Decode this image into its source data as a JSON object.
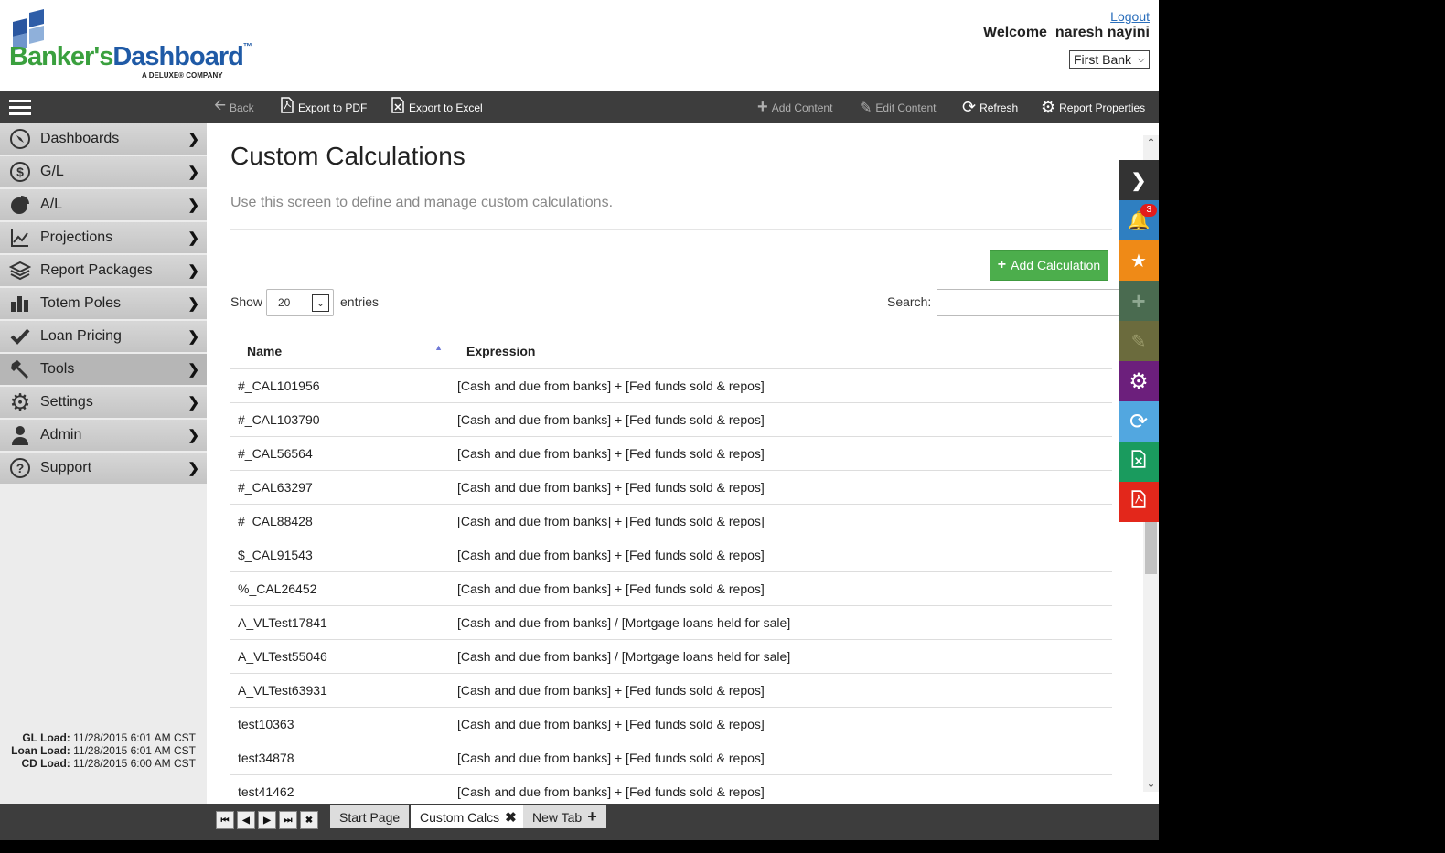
{
  "header": {
    "brand_part1": "Banker's",
    "brand_part2": "Dashboard",
    "brand_tm": "™",
    "tagline": "A DELUXE® COMPANY",
    "logout": "Logout",
    "welcome": "Welcome  naresh nayini",
    "bank": "First Bank",
    "colors": {
      "green": "#3aa03e",
      "blue": "#1f5aa6"
    }
  },
  "toolbar": {
    "back": "Back",
    "export_pdf": "Export to PDF",
    "export_excel": "Export to Excel",
    "add_content": "Add Content",
    "edit_content": "Edit Content",
    "refresh": "Refresh",
    "report_properties": "Report Properties"
  },
  "sidebar": {
    "items": [
      {
        "label": "Dashboards",
        "icon": "compass-icon"
      },
      {
        "label": "G/L",
        "icon": "dollar-icon"
      },
      {
        "label": "A/L",
        "icon": "pie-chart-icon"
      },
      {
        "label": "Projections",
        "icon": "line-chart-icon"
      },
      {
        "label": "Report Packages",
        "icon": "layers-icon"
      },
      {
        "label": "Totem Poles",
        "icon": "bar-chart-icon"
      },
      {
        "label": "Loan Pricing",
        "icon": "check-icon"
      },
      {
        "label": "Tools",
        "icon": "hammer-icon"
      },
      {
        "label": "Settings",
        "icon": "gear-icon"
      },
      {
        "label": "Admin",
        "icon": "user-icon"
      },
      {
        "label": "Support",
        "icon": "question-icon"
      }
    ],
    "loads": {
      "gl_label": "GL Load:",
      "gl_value": "11/28/2015 6:01 AM CST",
      "loan_label": "Loan Load:",
      "loan_value": "11/28/2015 6:01 AM CST",
      "cd_label": "CD Load:",
      "cd_value": "11/28/2015 6:00 AM CST"
    }
  },
  "main": {
    "title": "Custom Calculations",
    "description": "Use this screen to define and manage custom calculations.",
    "add_button": "Add Calculation",
    "show_label": "Show",
    "page_length": "20",
    "entries_label": "entries",
    "search_label": "Search:",
    "columns": {
      "name": "Name",
      "expression": "Expression"
    },
    "rows": [
      {
        "name": "#_CAL101956",
        "expression": "[Cash and due from banks] + [Fed funds sold & repos]"
      },
      {
        "name": "#_CAL103790",
        "expression": "[Cash and due from banks] + [Fed funds sold & repos]"
      },
      {
        "name": "#_CAL56564",
        "expression": "[Cash and due from banks] + [Fed funds sold & repos]"
      },
      {
        "name": "#_CAL63297",
        "expression": "[Cash and due from banks] + [Fed funds sold & repos]"
      },
      {
        "name": "#_CAL88428",
        "expression": "[Cash and due from banks] + [Fed funds sold & repos]"
      },
      {
        "name": "$_CAL91543",
        "expression": "[Cash and due from banks] + [Fed funds sold & repos]"
      },
      {
        "name": "%_CAL26452",
        "expression": "[Cash and due from banks] + [Fed funds sold & repos]"
      },
      {
        "name": "A_VLTest17841",
        "expression": "[Cash and due from banks] / [Mortgage loans held for sale]"
      },
      {
        "name": "A_VLTest55046",
        "expression": "[Cash and due from banks] / [Mortgage loans held for sale]"
      },
      {
        "name": "A_VLTest63931",
        "expression": "[Cash and due from banks] + [Fed funds sold & repos]"
      },
      {
        "name": "test10363",
        "expression": "[Cash and due from banks] + [Fed funds sold & repos]"
      },
      {
        "name": "test34878",
        "expression": "[Cash and due from banks] + [Fed funds sold & repos]"
      },
      {
        "name": "test41462",
        "expression": "[Cash and due from banks] + [Fed funds sold & repos]"
      }
    ]
  },
  "quick_panel": {
    "notification_count": "3",
    "colors": [
      "#333333",
      "#2f7fc1",
      "#ef8a17",
      "#4a6b50",
      "#6b6b3d",
      "#6c1f7c",
      "#52a7e0",
      "#1a9b5e",
      "#e3271b"
    ]
  },
  "bottom_tabs": [
    {
      "label": "Start Page"
    },
    {
      "label": "Custom Calcs"
    },
    {
      "label": "New Tab"
    }
  ]
}
